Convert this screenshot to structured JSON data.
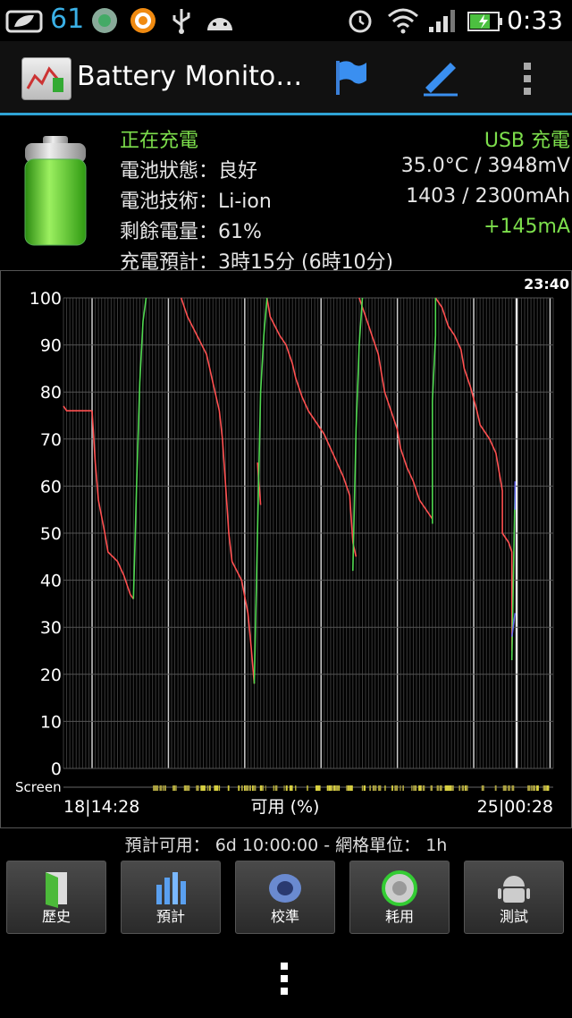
{
  "status_bar": {
    "battery_percent": "61",
    "clock": "0:33",
    "icons": [
      "leaf-icon",
      "recycle-icon",
      "orange-circle-icon",
      "usb-icon",
      "android-icon",
      "alarm-icon",
      "wifi-icon",
      "signal-icon",
      "battery-charging-icon"
    ]
  },
  "action_bar": {
    "title": "Battery Monito…",
    "icons": [
      "flag-icon",
      "pencil-icon",
      "overflow-icon"
    ]
  },
  "info": {
    "charging": "正在充電",
    "source": "USB 充電",
    "status_label": "電池狀態：良好",
    "temp_voltage": "35.0°C / 3948mV",
    "tech_label": "電池技術：Li-ion",
    "capacity": "1403 / 2300mAh",
    "remaining_label": "剩餘電量：61%",
    "current": "+145mA",
    "estimate_label": "充電預計：3時15分 (6時10分)"
  },
  "chart_data": {
    "type": "line",
    "ylim": [
      0,
      100
    ],
    "y_ticks": [
      "100",
      "90",
      "80",
      "70",
      "60",
      "50",
      "40",
      "30",
      "20",
      "10",
      "0"
    ],
    "x_start": "18|14:28",
    "x_end": "25|00:28",
    "xlabel": "可用 (%)",
    "time_label": "23:40",
    "screen_label": "Screen",
    "x_range": [
      0,
      154
    ],
    "series": [
      {
        "color": "#ff5050",
        "segments": [
          [
            [
              0,
              77
            ],
            [
              1,
              76
            ],
            [
              9,
              76
            ]
          ],
          [
            [
              9,
              76
            ],
            [
              10,
              65
            ],
            [
              11,
              57
            ],
            [
              13,
              50
            ],
            [
              14,
              46
            ],
            [
              17,
              44
            ],
            [
              19,
              41
            ],
            [
              21,
              37
            ],
            [
              22,
              36
            ]
          ],
          [
            [
              37,
              100
            ],
            [
              39,
              96
            ],
            [
              42,
              92
            ],
            [
              45,
              88
            ],
            [
              47,
              82
            ],
            [
              49,
              76
            ],
            [
              50,
              70
            ],
            [
              51,
              60
            ],
            [
              52,
              50
            ],
            [
              53,
              44
            ],
            [
              56,
              40
            ],
            [
              58,
              33
            ],
            [
              59,
              26
            ],
            [
              60,
              18
            ]
          ],
          [
            [
              61,
              65
            ],
            [
              62,
              56
            ]
          ],
          [
            [
              64,
              100
            ],
            [
              65,
              96
            ],
            [
              68,
              92
            ],
            [
              70,
              90
            ],
            [
              71,
              88
            ],
            [
              72,
              86
            ],
            [
              73,
              83
            ],
            [
              75,
              79
            ],
            [
              77,
              76
            ],
            [
              80,
              73
            ],
            [
              82,
              71
            ],
            [
              84,
              68
            ],
            [
              86,
              65
            ],
            [
              88,
              62
            ],
            [
              89,
              60
            ],
            [
              90,
              58
            ],
            [
              91,
              48
            ]
          ],
          [
            [
              91,
              48
            ],
            [
              92,
              45
            ]
          ],
          [
            [
              93,
              100
            ],
            [
              95,
              96
            ],
            [
              97,
              92
            ],
            [
              99,
              88
            ],
            [
              100,
              84
            ],
            [
              101,
              80
            ],
            [
              103,
              76
            ],
            [
              105,
              72
            ],
            [
              106,
              68
            ],
            [
              108,
              64
            ],
            [
              110,
              61
            ],
            [
              112,
              57
            ],
            [
              114,
              55
            ],
            [
              116,
              53
            ]
          ],
          [
            [
              117,
              100
            ],
            [
              119,
              98
            ],
            [
              121,
              94
            ],
            [
              123,
              92
            ],
            [
              125,
              89
            ],
            [
              126,
              85
            ],
            [
              128,
              81
            ],
            [
              130,
              76
            ],
            [
              131,
              73
            ],
            [
              134,
              70
            ],
            [
              136,
              67
            ],
            [
              137,
              63
            ],
            [
              138,
              59
            ],
            [
              138,
              50
            ],
            [
              140,
              48
            ],
            [
              141,
              46
            ],
            [
              141,
              25
            ]
          ]
        ]
      },
      {
        "color": "#50d850",
        "segments": [
          [
            [
              22,
              36
            ],
            [
              23,
              60
            ],
            [
              24,
              82
            ],
            [
              25,
              95
            ],
            [
              26,
              100
            ]
          ],
          [
            [
              60,
              18
            ],
            [
              61,
              50
            ],
            [
              62,
              80
            ],
            [
              63,
              92
            ],
            [
              64,
              100
            ]
          ],
          [
            [
              91,
              42
            ],
            [
              92,
              72
            ],
            [
              93,
              90
            ],
            [
              94,
              100
            ]
          ],
          [
            [
              116,
              52
            ],
            [
              116,
              78
            ],
            [
              117,
              92
            ],
            [
              117,
              100
            ]
          ],
          [
            [
              141,
              23
            ],
            [
              142,
              60
            ]
          ]
        ]
      },
      {
        "color": "#6a6af0",
        "segments": [
          [
            [
              141,
              28
            ],
            [
              142,
              33
            ]
          ],
          [
            [
              142,
              55
            ],
            [
              142,
              61
            ]
          ]
        ]
      }
    ]
  },
  "forecast": "預計可用： 6d 10:00:00 - 網格單位： 1h",
  "buttons": [
    {
      "label": "歷史",
      "icon": "history-icon"
    },
    {
      "label": "預計",
      "icon": "forecast-icon"
    },
    {
      "label": "校準",
      "icon": "calibrate-icon"
    },
    {
      "label": "耗用",
      "icon": "usage-icon"
    },
    {
      "label": "測試",
      "icon": "test-icon"
    }
  ],
  "colors": {
    "accent": "#2fa3d5",
    "green": "#7ddf4c",
    "red": "#ff5050"
  }
}
